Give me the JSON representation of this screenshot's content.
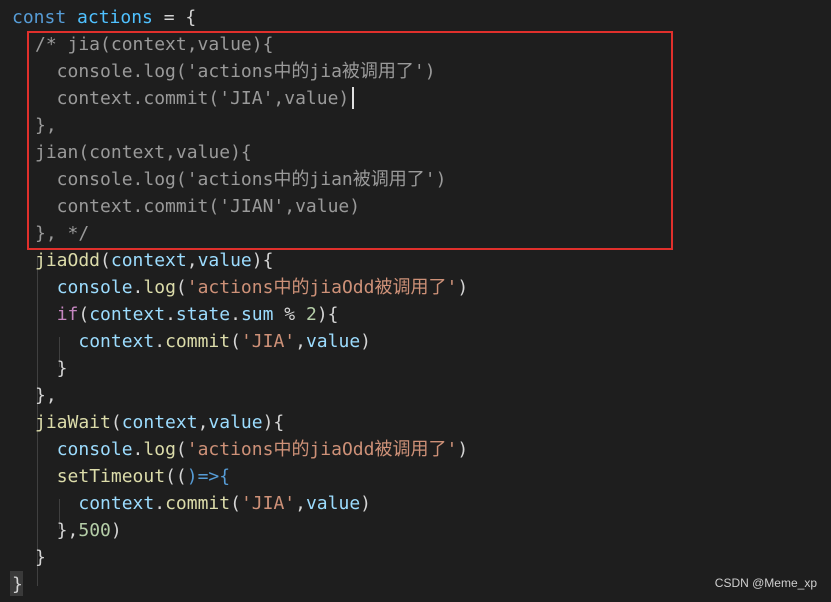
{
  "editor": {
    "lines": [
      {
        "tokens": [
          [
            "const ",
            "keyword"
          ],
          [
            "actions",
            "const-var"
          ],
          [
            " = {",
            "punct"
          ]
        ]
      },
      {
        "tokens": [
          [
            "/* jia(context,value){",
            "comment"
          ]
        ]
      },
      {
        "tokens": [
          [
            "  console.log('actions中的jia被调用了')",
            "comment"
          ]
        ]
      },
      {
        "tokens": [
          [
            "  context.commit('JIA',value)",
            "comment"
          ]
        ]
      },
      {
        "tokens": [
          [
            "},",
            "comment"
          ]
        ]
      },
      {
        "tokens": [
          [
            "jian(context,value){",
            "comment"
          ]
        ]
      },
      {
        "tokens": [
          [
            "  console.log('actions中的jian被调用了')",
            "comment"
          ]
        ]
      },
      {
        "tokens": [
          [
            "  context.commit('JIAN',value)",
            "comment"
          ]
        ]
      },
      {
        "tokens": [
          [
            "}, */",
            "comment"
          ]
        ]
      },
      {
        "tokens": [
          [
            "jiaOdd",
            "fn-def"
          ],
          [
            "(",
            "punct"
          ],
          [
            "context",
            "param"
          ],
          [
            ",",
            "punct"
          ],
          [
            "value",
            "param"
          ],
          [
            "){",
            "punct"
          ]
        ]
      },
      {
        "tokens": [
          [
            "  ",
            "punct"
          ],
          [
            "console",
            "prop"
          ],
          [
            ".",
            "punct"
          ],
          [
            "log",
            "func"
          ],
          [
            "(",
            "punct"
          ],
          [
            "'actions中的jiaOdd被调用了'",
            "string"
          ],
          [
            ")",
            "punct"
          ]
        ]
      },
      {
        "tokens": [
          [
            "  ",
            "punct"
          ],
          [
            "if",
            "keyword-ctrl"
          ],
          [
            "(",
            "punct"
          ],
          [
            "context",
            "param"
          ],
          [
            ".",
            "punct"
          ],
          [
            "state",
            "prop"
          ],
          [
            ".",
            "punct"
          ],
          [
            "sum",
            "prop"
          ],
          [
            " % ",
            "punct"
          ],
          [
            "2",
            "number"
          ],
          [
            "){",
            "punct"
          ]
        ]
      },
      {
        "tokens": [
          [
            "    ",
            "punct"
          ],
          [
            "context",
            "param"
          ],
          [
            ".",
            "punct"
          ],
          [
            "commit",
            "func"
          ],
          [
            "(",
            "punct"
          ],
          [
            "'JIA'",
            "string"
          ],
          [
            ",",
            "punct"
          ],
          [
            "value",
            "param"
          ],
          [
            ")",
            "punct"
          ]
        ]
      },
      {
        "tokens": [
          [
            "  }",
            "punct"
          ]
        ]
      },
      {
        "tokens": [
          [
            "},",
            "punct"
          ]
        ]
      },
      {
        "tokens": [
          [
            "jiaWait",
            "fn-def"
          ],
          [
            "(",
            "punct"
          ],
          [
            "context",
            "param"
          ],
          [
            ",",
            "punct"
          ],
          [
            "value",
            "param"
          ],
          [
            "){",
            "punct"
          ]
        ]
      },
      {
        "tokens": [
          [
            "  ",
            "punct"
          ],
          [
            "console",
            "prop"
          ],
          [
            ".",
            "punct"
          ],
          [
            "log",
            "func"
          ],
          [
            "(",
            "punct"
          ],
          [
            "'actions中的jiaOdd被调用了'",
            "string"
          ],
          [
            ")",
            "punct"
          ]
        ]
      },
      {
        "tokens": [
          [
            "  ",
            "punct"
          ],
          [
            "setTimeout",
            "func"
          ],
          [
            "((",
            "punct"
          ],
          [
            ")=>{",
            "keyword"
          ]
        ]
      },
      {
        "tokens": [
          [
            "    ",
            "punct"
          ],
          [
            "context",
            "param"
          ],
          [
            ".",
            "punct"
          ],
          [
            "commit",
            "func"
          ],
          [
            "(",
            "punct"
          ],
          [
            "'JIA'",
            "string"
          ],
          [
            ",",
            "punct"
          ],
          [
            "value",
            "param"
          ],
          [
            ")",
            "punct"
          ]
        ]
      },
      {
        "tokens": [
          [
            "  },",
            "punct"
          ],
          [
            "500",
            "number"
          ],
          [
            ")",
            "punct"
          ]
        ]
      },
      {
        "tokens": [
          [
            "}",
            "punct"
          ]
        ]
      },
      {
        "tokens": [
          [
            "}",
            "punct"
          ]
        ]
      }
    ]
  },
  "colors": {
    "background": "#1e1e1e",
    "highlight_border": "#e0302c"
  },
  "watermark": "CSDN @Meme_xp"
}
